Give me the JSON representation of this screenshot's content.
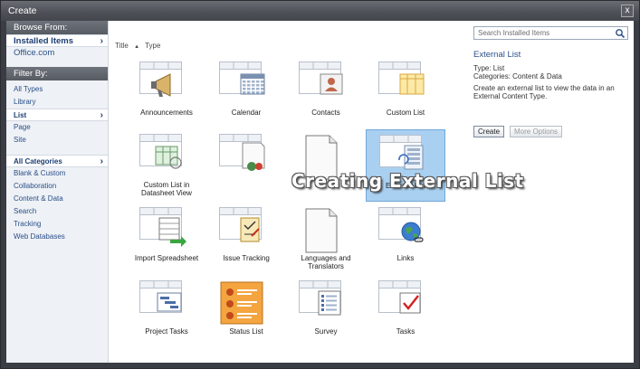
{
  "window": {
    "title": "Create",
    "close_glyph": "x"
  },
  "sidebar": {
    "browse_header": "Browse From:",
    "browse_items": [
      {
        "label": "Installed Items",
        "selected": true
      },
      {
        "label": "Office.com",
        "selected": false
      }
    ],
    "filter_header": "Filter By:",
    "filter_types": [
      {
        "label": "All Types",
        "selected": false
      },
      {
        "label": "Library",
        "selected": false
      },
      {
        "label": "List",
        "selected": true
      },
      {
        "label": "Page",
        "selected": false
      },
      {
        "label": "Site",
        "selected": false
      }
    ],
    "categories": [
      {
        "label": "All Categories",
        "selected": true
      },
      {
        "label": "Blank & Custom",
        "selected": false
      },
      {
        "label": "Collaboration",
        "selected": false
      },
      {
        "label": "Content & Data",
        "selected": false
      },
      {
        "label": "Search",
        "selected": false
      },
      {
        "label": "Tracking",
        "selected": false
      },
      {
        "label": "Web Databases",
        "selected": false
      }
    ]
  },
  "sort": {
    "title_label": "Title",
    "title_arrow": "▲",
    "type_label": "Type"
  },
  "tiles": [
    {
      "label": "Announcements",
      "icon": "megaphone-icon",
      "selected": false
    },
    {
      "label": "Calendar",
      "icon": "calendar-icon",
      "selected": false
    },
    {
      "label": "Contacts",
      "icon": "contact-card-icon",
      "selected": false
    },
    {
      "label": "Custom List",
      "icon": "custom-list-icon",
      "selected": false
    },
    {
      "label": "Custom List in Datasheet View",
      "icon": "datasheet-icon",
      "selected": false
    },
    {
      "label": "",
      "icon": "data-source-list-icon",
      "selected": false
    },
    {
      "label": "",
      "icon": "document-icon",
      "selected": false
    },
    {
      "label": "External List",
      "icon": "external-list-icon",
      "selected": true
    },
    {
      "label": "Import Spreadsheet",
      "icon": "import-spreadsheet-icon",
      "selected": false
    },
    {
      "label": "Issue Tracking",
      "icon": "issue-tracking-icon",
      "selected": false
    },
    {
      "label": "Languages and Translators",
      "icon": "document-icon",
      "selected": false
    },
    {
      "label": "Links",
      "icon": "globe-link-icon",
      "selected": false
    },
    {
      "label": "Project Tasks",
      "icon": "gantt-icon",
      "selected": false
    },
    {
      "label": "Status List",
      "icon": "status-list-icon",
      "selected": false
    },
    {
      "label": "Survey",
      "icon": "survey-icon",
      "selected": false
    },
    {
      "label": "Tasks",
      "icon": "task-check-icon",
      "selected": false
    }
  ],
  "overlay_caption": "Creating External List",
  "details": {
    "search_placeholder": "Search Installed Items",
    "title": "External List",
    "type_line": "Type: List",
    "categories_line": "Categories: Content & Data",
    "description": "Create an external list to view the data in an External Content Type.",
    "create_button": "Create",
    "more_options_button": "More Options"
  },
  "colors": {
    "accent": "#2a4f8a",
    "selection": "#a9d0f1",
    "sidebar_bg": "#eef1f5",
    "chrome": "#3a3d44"
  }
}
